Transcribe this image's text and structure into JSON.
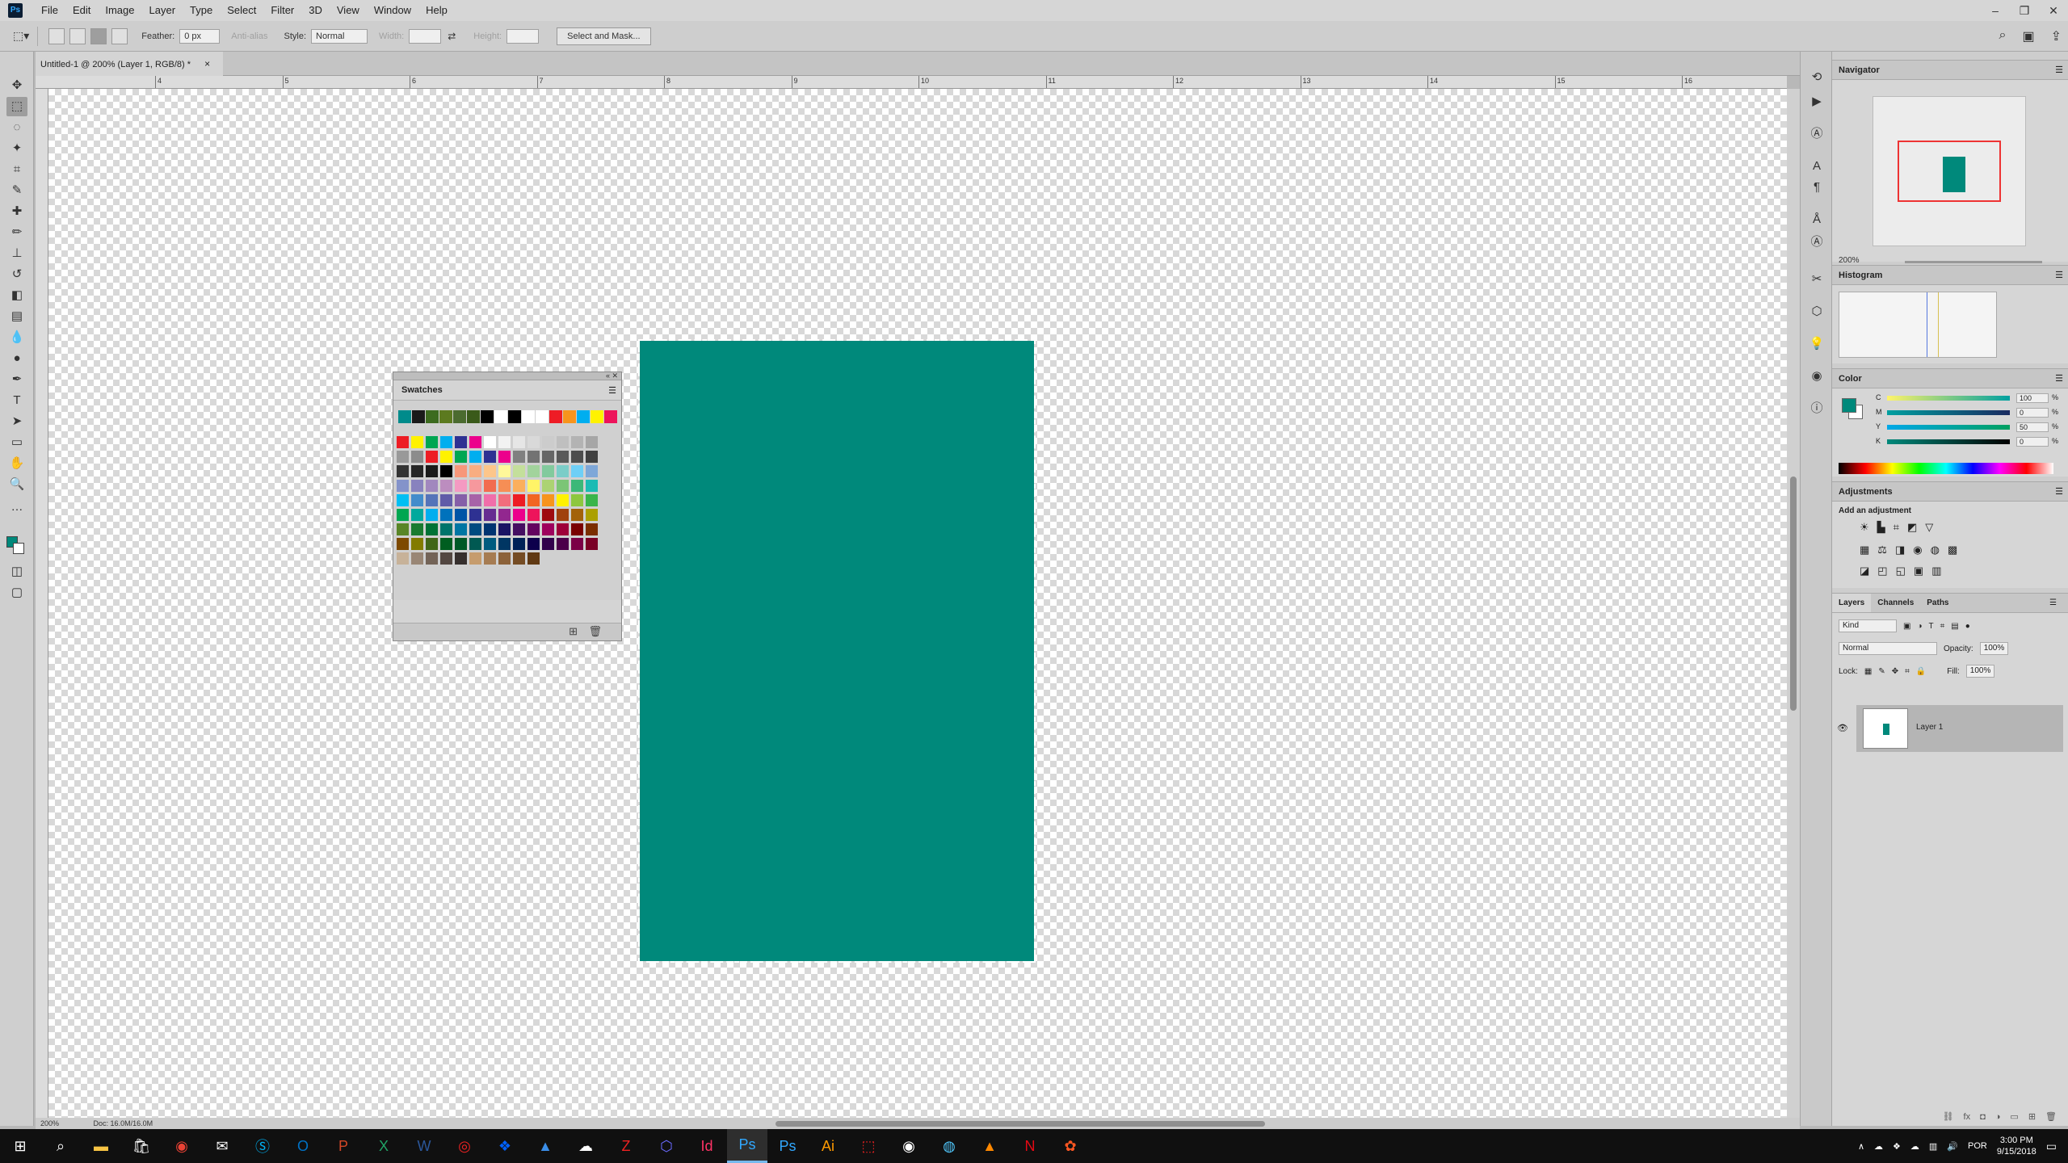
{
  "app": {
    "logo": "Ps"
  },
  "menu": [
    "File",
    "Edit",
    "Image",
    "Layer",
    "Type",
    "Select",
    "Filter",
    "3D",
    "View",
    "Window",
    "Help"
  ],
  "window_controls": [
    "–",
    "❐",
    "✕"
  ],
  "options": {
    "feather_label": "Feather:",
    "feather_value": "0 px",
    "antialias_label": "Anti-alias",
    "style_label": "Style:",
    "style_value": "Normal",
    "width_label": "Width:",
    "height_label": "Height:",
    "select_mask_button": "Select and Mask..."
  },
  "document": {
    "tab_title": "Untitled-1 @ 200% (Layer 1, RGB/8) *",
    "close": "×"
  },
  "ruler": {
    "h_labels": [
      "4",
      "5",
      "6",
      "7",
      "8",
      "9",
      "10",
      "11",
      "12",
      "13",
      "14",
      "15",
      "16"
    ]
  },
  "status": {
    "zoom": "200%",
    "doc": "Doc: 16.0M/16.0M"
  },
  "swatches": {
    "title": "Swatches",
    "recent": [
      "#008b8b",
      "#1a1a1a",
      "#3d6b1f",
      "#5c7a1f",
      "#4b6b2f",
      "#3a5a1a",
      "#000000",
      "#ffffff",
      "#000000",
      "#ffffff",
      "#ffffff",
      "#ee1c25",
      "#f7941d",
      "#00aeef",
      "#fff200",
      "#ed145b"
    ],
    "grid": [
      [
        "#ed1c24",
        "#fff200",
        "#00a651",
        "#00aeef",
        "#2e3192",
        "#ec008c",
        "#ffffff",
        "#f2f2f2",
        "#e6e6e6",
        "#d9d9d9",
        "#cccccc",
        "#bfbfbf",
        "#b3b3b3",
        "#a6a6a6"
      ],
      [
        "#999999",
        "#8c8c8c",
        "#ed1c24",
        "#fff200",
        "#00a651",
        "#00aeef",
        "#2e3192",
        "#ec008c",
        "#808080",
        "#737373",
        "#666666",
        "#595959",
        "#4d4d4d",
        "#404040"
      ],
      [
        "#333333",
        "#262626",
        "#1a1a1a",
        "#000000",
        "#f7977a",
        "#f9ad81",
        "#fdc68a",
        "#fff79a",
        "#c4df9b",
        "#a2d39c",
        "#82ca9d",
        "#7bcdc8",
        "#6ecff6",
        "#7ea7d8"
      ],
      [
        "#8493ca",
        "#8882be",
        "#a187be",
        "#bc8dbf",
        "#f49ac2",
        "#f6989d",
        "#f26c4f",
        "#f68e55",
        "#fbaf5c",
        "#fff467",
        "#acd372",
        "#7cc576",
        "#3bb878",
        "#1abbb4"
      ],
      [
        "#00bff3",
        "#438ccb",
        "#5574b9",
        "#605ca8",
        "#855fa8",
        "#a763a8",
        "#f06eaa",
        "#f26d7d",
        "#ed1c24",
        "#f26522",
        "#f7941d",
        "#fff200",
        "#8dc73f",
        "#39b54a"
      ],
      [
        "#00a651",
        "#00a99d",
        "#00aeef",
        "#0072bc",
        "#0054a6",
        "#2e3192",
        "#662d91",
        "#92278f",
        "#ec008c",
        "#ed145b",
        "#9e0b0f",
        "#a0410d",
        "#a36209",
        "#aba000"
      ],
      [
        "#598527",
        "#197b30",
        "#007236",
        "#00746b",
        "#0076a3",
        "#004b80",
        "#003471",
        "#1b1464",
        "#440e62",
        "#630460",
        "#9e005d",
        "#9e0039",
        "#790000",
        "#7b2e00"
      ],
      [
        "#7d4900",
        "#827b00",
        "#406618",
        "#005e20",
        "#005826",
        "#005952",
        "#005b7f",
        "#003663",
        "#002157",
        "#0d004c",
        "#32004b",
        "#4b0049",
        "#7b0046",
        "#7a0026"
      ],
      [
        "#c7b299",
        "#998675",
        "#736357",
        "#534741",
        "#362f2d",
        "#c69c6d",
        "#a67c52",
        "#8c6239",
        "#754c24",
        "#603913"
      ]
    ]
  },
  "navigator": {
    "title": "Navigator",
    "zoom": "200%"
  },
  "histogram": {
    "title": "Histogram"
  },
  "color": {
    "title": "Color",
    "channels": [
      {
        "label": "C",
        "value": "100",
        "pct": "%"
      },
      {
        "label": "M",
        "value": "0",
        "pct": "%"
      },
      {
        "label": "Y",
        "value": "50",
        "pct": "%"
      },
      {
        "label": "K",
        "value": "0",
        "pct": "%"
      }
    ]
  },
  "adjustments": {
    "title": "Adjustments",
    "add_label": "Add an adjustment"
  },
  "layers": {
    "tabs": [
      "Layers",
      "Channels",
      "Paths"
    ],
    "kind": "Kind",
    "blend": "Normal",
    "opacity_label": "Opacity:",
    "opacity": "100%",
    "lock_label": "Lock:",
    "fill_label": "Fill:",
    "fill": "100%",
    "layer_name": "Layer 1"
  },
  "taskbar": {
    "time": "3:00 PM",
    "date": "9/15/2018",
    "lang": "POR"
  },
  "colors": {
    "teal": "#00897b"
  }
}
